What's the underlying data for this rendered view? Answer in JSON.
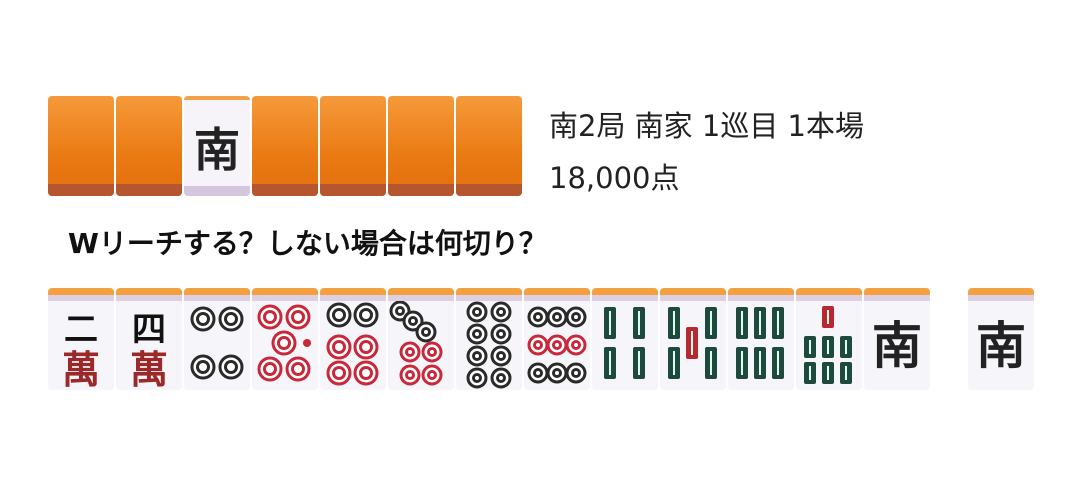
{
  "wall": {
    "tiles": [
      "back",
      "back",
      "S",
      "back",
      "back",
      "back",
      "back"
    ],
    "dora_indicator": "S"
  },
  "info": {
    "round": "南2局 南家 1巡目 1本場",
    "points": "18,000点"
  },
  "question": "Wリーチする？しない場合は何切り？",
  "hand": [
    "2m",
    "4m",
    "4p",
    "5p",
    "6p",
    "7p",
    "8p",
    "9p",
    "4s",
    "5s",
    "6s",
    "7s",
    "S"
  ],
  "drawn": "S",
  "labels": {
    "m": "萬",
    "2": "二",
    "4": "四",
    "S": "南"
  },
  "colors": {
    "tile_back": "#ea7a12",
    "pin_black": "#2a2a2a",
    "pin_red": "#c8283a",
    "sou_green": "#1e4a3e",
    "sou_red": "#b8282e",
    "man_red": "#9a2a2a"
  }
}
